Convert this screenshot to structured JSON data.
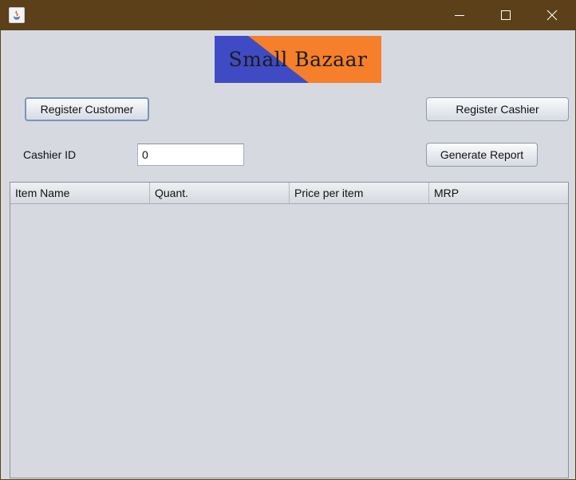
{
  "window": {
    "title": "",
    "title_bar_color": "#5b4019"
  },
  "title_bar": {
    "app_icon": "java-icon",
    "minimize_icon": "minimize-icon",
    "maximize_icon": "maximize-icon",
    "close_icon": "close-icon"
  },
  "logo": {
    "text": "Small Bazaar",
    "colors": {
      "left": "#3f4bc4",
      "right": "#f57f2a"
    }
  },
  "buttons": {
    "register_customer": "Register Customer",
    "register_cashier": "Register Cashier",
    "generate_report": "Generate Report"
  },
  "cashier": {
    "label": "Cashier ID",
    "value": "0"
  },
  "table": {
    "columns": [
      "Item Name",
      "Quant.",
      "Price per item",
      "MRP"
    ],
    "rows": []
  }
}
